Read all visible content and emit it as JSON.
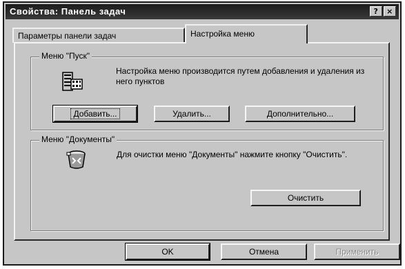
{
  "window": {
    "title": "Свойства: Панель задач",
    "help_glyph": "?",
    "close_glyph": "×"
  },
  "tabs": [
    {
      "label": "Параметры панели задач",
      "active": false
    },
    {
      "label": "Настройка меню",
      "active": true
    }
  ],
  "start_menu_group": {
    "legend": "Меню \"Пуск\"",
    "description": "Настройка меню производится путем добавления и удаления из него пунктов",
    "icon": "start-menu-icon",
    "buttons": {
      "add": "Добавить...",
      "remove": "Удалить...",
      "advanced": "Дополнительно..."
    }
  },
  "documents_group": {
    "legend": "Меню \"Документы\"",
    "description": "Для очистки меню \"Документы\" нажмите кнопку \"Очистить\".",
    "icon": "recycle-bin-icon",
    "clear_button": "Очистить"
  },
  "footer": {
    "ok": "OK",
    "cancel": "Отмена",
    "apply": "Применить",
    "apply_enabled": false
  }
}
